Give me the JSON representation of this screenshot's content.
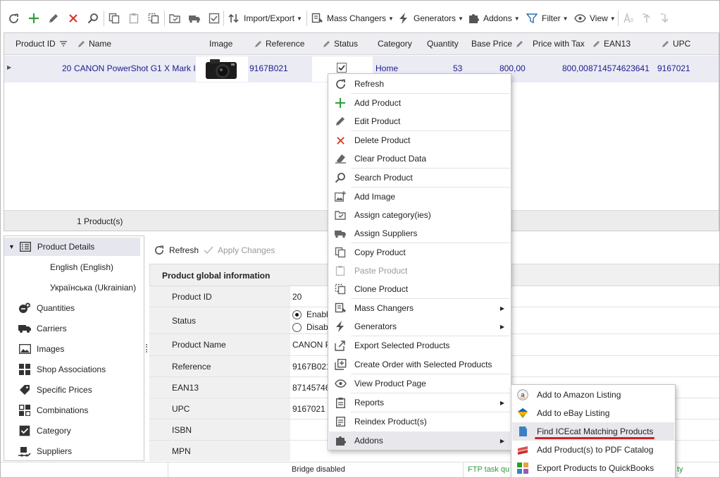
{
  "toolbar": {
    "import_export": "Import/Export",
    "mass_changers": "Mass Changers",
    "generators": "Generators",
    "addons": "Addons",
    "filter": "Filter",
    "view": "View"
  },
  "grid": {
    "columns": [
      "Product ID",
      "Name",
      "Image",
      "Reference",
      "Status",
      "Category",
      "Quantity",
      "Base Price",
      "Price with Tax",
      "EAN13",
      "UPC"
    ],
    "row": {
      "id": "20",
      "name": "CANON PowerShot G1 X Mark II",
      "reference": "9167B021",
      "category": "Home",
      "quantity": "53",
      "base_price": "800,00",
      "price_with_tax": "800,00",
      "ean13": "8714574623641",
      "upc": "9167021"
    },
    "footer": "1 Product(s)"
  },
  "tree": {
    "items": [
      "Product Details",
      "English (English)",
      "Українська (Ukrainian)",
      "Quantities",
      "Carriers",
      "Images",
      "Shop Associations",
      "Specific Prices",
      "Combinations",
      "Category",
      "Suppliers"
    ]
  },
  "detail": {
    "refresh": "Refresh",
    "apply": "Apply Changes",
    "section_title": "Product global information",
    "labels": [
      "Product ID",
      "Status",
      "Product Name",
      "Reference",
      "EAN13",
      "UPC",
      "ISBN",
      "MPN"
    ],
    "values": {
      "product_id": "20",
      "status_enabled": "Enabl",
      "status_disabled": "Disab",
      "product_name": "CANON P",
      "reference": "9167B021",
      "ean13": "871457462",
      "upc": "9167021"
    }
  },
  "statusbar": {
    "bridge": "Bridge disabled",
    "ftp": "FTP task qu",
    "tail": "ty"
  },
  "context_menu": {
    "items": [
      {
        "label": "Refresh",
        "icon": "refresh-icon"
      },
      {
        "label": "Add Product",
        "icon": "plus-icon"
      },
      {
        "label": "Edit Product",
        "icon": "pencil-icon"
      },
      {
        "label": "Delete Product",
        "icon": "delete-icon"
      },
      {
        "label": "Clear Product Data",
        "icon": "eraser-icon"
      },
      {
        "label": "Search Product",
        "icon": "search-icon"
      },
      {
        "label": "Add Image",
        "icon": "add-image-icon"
      },
      {
        "label": "Assign category(ies)",
        "icon": "assign-category-icon"
      },
      {
        "label": "Assign Suppliers",
        "icon": "truck-icon"
      },
      {
        "label": "Copy Product",
        "icon": "copy-icon"
      },
      {
        "label": "Paste Product",
        "icon": "paste-icon"
      },
      {
        "label": "Clone Product",
        "icon": "clone-icon"
      },
      {
        "label": "Mass Changers",
        "icon": "mass-changers-icon"
      },
      {
        "label": "Generators",
        "icon": "lightning-icon"
      },
      {
        "label": "Export Selected Products",
        "icon": "export-icon"
      },
      {
        "label": "Create Order with Selected Products",
        "icon": "create-order-icon"
      },
      {
        "label": "View Product Page",
        "icon": "eye-icon"
      },
      {
        "label": "Reports",
        "icon": "reports-icon"
      },
      {
        "label": "Reindex Product(s)",
        "icon": "reindex-icon"
      },
      {
        "label": "Addons",
        "icon": "puzzle-icon"
      }
    ]
  },
  "submenu": {
    "items": [
      {
        "label": "Add to Amazon Listing",
        "icon": "amazon-icon"
      },
      {
        "label": "Add to eBay Listing",
        "icon": "ebay-icon"
      },
      {
        "label": "Find ICEcat Matching Products",
        "icon": "icecat-icon"
      },
      {
        "label": "Add Product(s) to PDF Catalog",
        "icon": "pdf-catalog-icon"
      },
      {
        "label": "Export Products to QuickBooks",
        "icon": "quickbooks-icon"
      }
    ]
  },
  "colors": {
    "accent_blue": "#1a1a8f",
    "green": "#2e9e3a",
    "red": "#d9362b",
    "underline": "#d11f26"
  }
}
